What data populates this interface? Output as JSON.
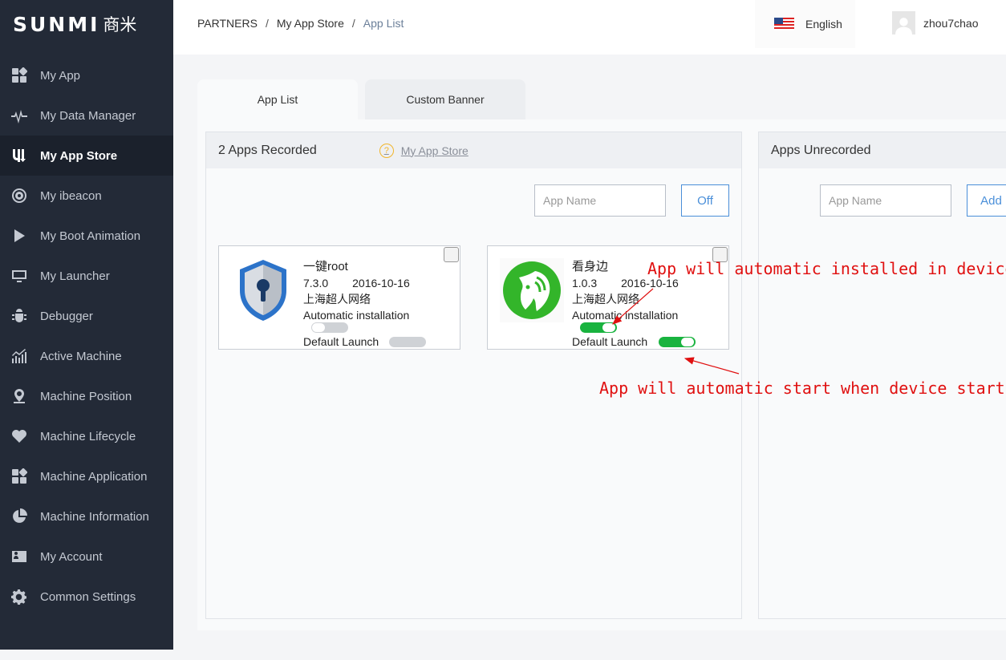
{
  "brand": {
    "logo_text": "SUNMI",
    "logo_cn": "商米"
  },
  "sidebar": {
    "items": [
      {
        "label": "My App",
        "icon": "grid-icon"
      },
      {
        "label": "My Data Manager",
        "icon": "pulse-icon"
      },
      {
        "label": "My App Store",
        "icon": "store-icon",
        "active": true
      },
      {
        "label": "My ibeacon",
        "icon": "beacon-icon"
      },
      {
        "label": "My Boot Animation",
        "icon": "play-icon"
      },
      {
        "label": "My Launcher",
        "icon": "monitor-icon"
      },
      {
        "label": "Debugger",
        "icon": "bug-icon"
      },
      {
        "label": "Active Machine",
        "icon": "bar-chart-icon"
      },
      {
        "label": "Machine Position",
        "icon": "location-pin-icon"
      },
      {
        "label": "Machine Lifecycle",
        "icon": "heart-pulse-icon"
      },
      {
        "label": "Machine Application",
        "icon": "grid-icon"
      },
      {
        "label": "Machine Information",
        "icon": "pie-icon"
      },
      {
        "label": "My Account",
        "icon": "id-card-icon"
      },
      {
        "label": "Common Settings",
        "icon": "gear-icon"
      }
    ]
  },
  "header": {
    "breadcrumb": [
      "PARTNERS",
      "My App Store",
      "App List"
    ],
    "separator": "/",
    "language": "English",
    "username": "zhou7chao"
  },
  "tabs": [
    "App List",
    "Custom Banner"
  ],
  "recorded": {
    "title": "2 Apps Recorded",
    "help_mark": "?",
    "help_link": "My App Store",
    "search_placeholder": "App Name",
    "button": "Off",
    "apps": [
      {
        "name": "一键root",
        "version": "7.3.0",
        "date": "2016-10-16",
        "publisher": "上海超人网络",
        "auto_install_label": "Automatic installation",
        "auto_install": false,
        "default_launch_label": "Default Launch",
        "default_launch": false,
        "icon": "shield-keyhole-icon"
      },
      {
        "name": "看身边",
        "version": "1.0.3",
        "date": "2016-10-16",
        "publisher": "上海超人网络",
        "auto_install_label": "Automatic installation",
        "auto_install": true,
        "default_launch_label": "Default Launch",
        "default_launch": true,
        "icon": "horse-logo-icon"
      }
    ]
  },
  "unrecorded": {
    "title": "Apps Unrecorded",
    "search_placeholder": "App Name",
    "button": "Add"
  },
  "annotations": {
    "install": "App will automatic installed in device",
    "start": "App will automatic start when device start"
  },
  "colors": {
    "sidebar_bg": "#232a37",
    "accent_blue": "#4a8fd9",
    "toggle_on": "#19b33f",
    "annotation_red": "#e01010"
  }
}
